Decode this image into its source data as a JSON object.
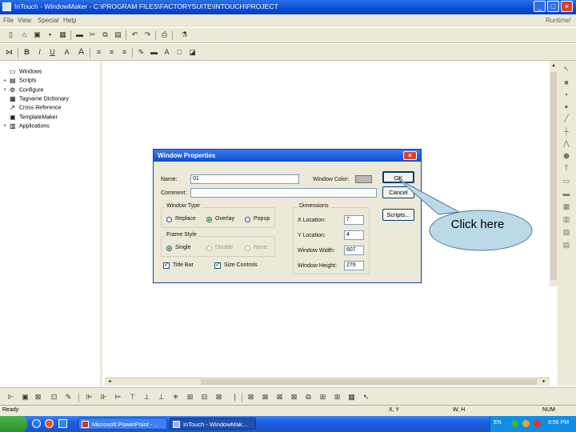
{
  "window": {
    "title": "InTouch - WindowMaker - C:\\PROGRAM FILES\\FACTORYSUITE\\INTOUCH\\PROJECT",
    "minimize_label": "_",
    "maximize_label": "□",
    "close_label": "×"
  },
  "menubar": {
    "items": [
      "File",
      "View",
      "Special",
      "Help"
    ],
    "runtime_label": "Runtime!"
  },
  "tree": {
    "items": [
      {
        "label": "Windows",
        "expander": "",
        "icon": "window-icon"
      },
      {
        "label": "Scripts",
        "expander": "+",
        "icon": "scripts-icon"
      },
      {
        "label": "Configure",
        "expander": "+",
        "icon": "configure-icon"
      },
      {
        "label": "Tagname Dictionary",
        "expander": "",
        "icon": "tagname-dictionary-icon"
      },
      {
        "label": "Cross Reference",
        "expander": "",
        "icon": "cross-reference-icon"
      },
      {
        "label": "TemplateMaker",
        "expander": "",
        "icon": "template-maker-icon"
      },
      {
        "label": "Applications",
        "expander": "+",
        "icon": "applications-icon"
      }
    ]
  },
  "dialog": {
    "title": "Window Properties",
    "close_label": "×",
    "name_label": "Name:",
    "name_value": "01",
    "window_color_label": "Window Color:",
    "comment_label": "Comment:",
    "comment_value": "",
    "ok_label": "OK",
    "cancel_label": "Cancel",
    "scripts_label": "Scripts...",
    "window_type": {
      "label": "Window Type",
      "options": [
        "Replace",
        "Overlay",
        "Popup"
      ],
      "selected": "Overlay"
    },
    "frame_style": {
      "label": "Frame Style",
      "options": [
        "Single",
        "Double",
        "None"
      ],
      "selected": "Single"
    },
    "title_bar_label": "Title Bar",
    "title_bar_checked": true,
    "size_controls_label": "Size Controls",
    "size_controls_checked": true,
    "dimensions": {
      "label": "Dimensions",
      "x_location_label": "X Location:",
      "x_location_value": "7",
      "y_location_label": "Y Location:",
      "y_location_value": "4",
      "width_label": "Window Width:",
      "width_value": "607",
      "height_label": "Window Height:",
      "height_value": "276"
    },
    "window_color": "#b8b8b8"
  },
  "callout": {
    "text": "Click here",
    "fill": "#bcd9e8"
  },
  "status": {
    "ready": "Ready",
    "xy": "X, Y",
    "wh": "W, H",
    "num": "NUM"
  },
  "taskbar": {
    "tasks": [
      "Microsoft PowerPoint - ...",
      "InTouch - WindowMak..."
    ],
    "tray_lang": "EN",
    "tray_time": "8:56 PM"
  }
}
